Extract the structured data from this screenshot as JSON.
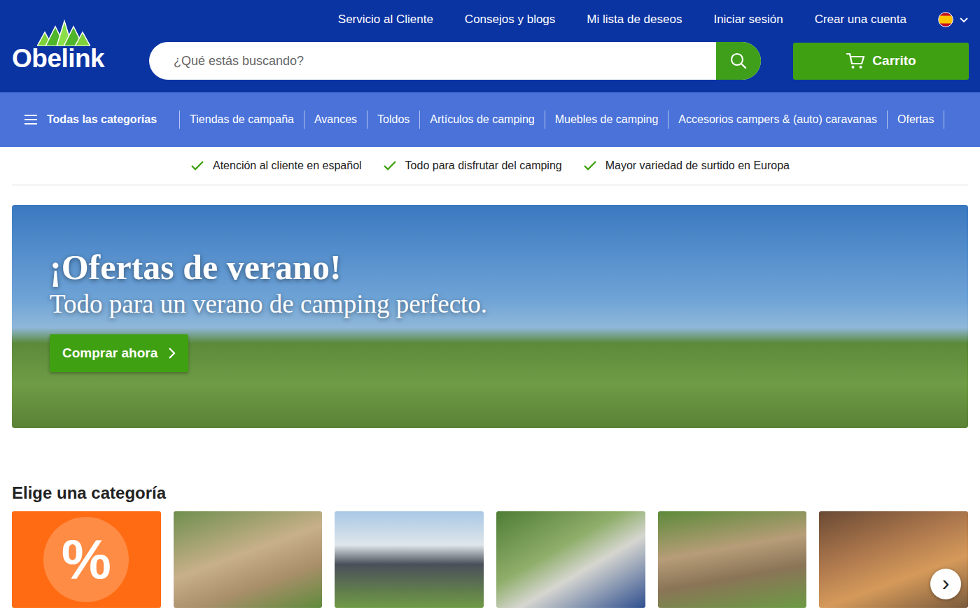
{
  "logo": {
    "text": "Obelink"
  },
  "top_links": [
    "Servicio al Cliente",
    "Consejos y blogs",
    "Mi lista de deseos",
    "Iniciar sesión",
    "Crear una cuenta"
  ],
  "search": {
    "placeholder": "¿Qué estás buscando?"
  },
  "cart": {
    "label": "Carrito"
  },
  "nav": {
    "all_categories": "Todas las categorías",
    "items": [
      "Tiendas de campaña",
      "Avances",
      "Toldos",
      "Artículos de camping",
      "Muebles de camping",
      "Accesorios campers & (auto) caravanas",
      "Ofertas"
    ]
  },
  "usps": [
    "Atención al cliente en español",
    "Todo para disfrutar del camping",
    "Mayor variedad de surtido en Europa"
  ],
  "hero": {
    "title": "¡Ofertas de verano!",
    "subtitle": "Todo para un verano de camping perfecto.",
    "button": "Comprar ahora"
  },
  "categories": {
    "heading": "Elige una categoría",
    "tiles": [
      {
        "kind": "badge",
        "text": "%"
      },
      {
        "kind": "photo"
      },
      {
        "kind": "photo"
      },
      {
        "kind": "photo"
      },
      {
        "kind": "photo"
      },
      {
        "kind": "photo"
      }
    ],
    "next": "›"
  }
}
